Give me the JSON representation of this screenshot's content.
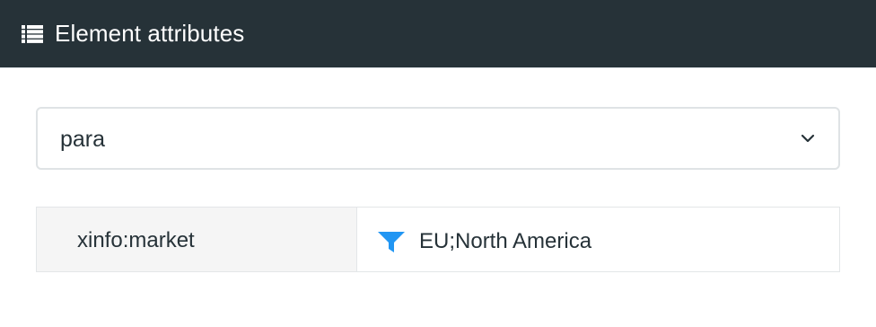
{
  "header": {
    "icon": "list-icon",
    "title": "Element attributes"
  },
  "element_select": {
    "selected_value": "para",
    "icon": "chevron-down-icon"
  },
  "attributes": [
    {
      "name": "xinfo:market",
      "value": "EU;North America",
      "value_icon": "filter-icon"
    }
  ],
  "colors": {
    "header_bg": "#263238",
    "filter_icon": "#2196f3",
    "name_cell_bg": "#f5f5f5"
  }
}
